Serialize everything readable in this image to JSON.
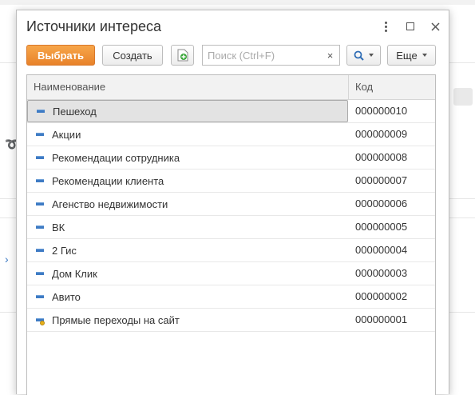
{
  "dialog": {
    "title": "Источники интереса",
    "window_controls": [
      "more-vert-icon",
      "maximize-icon",
      "close-icon"
    ]
  },
  "toolbar": {
    "select_label": "Выбрать",
    "create_label": "Создать",
    "add_icon": "add-document-icon",
    "search_placeholder": "Поиск (Ctrl+F)",
    "search_value": "",
    "clear_label": "×",
    "search_icon": "search-icon",
    "more_label": "Еще"
  },
  "table": {
    "columns": {
      "name": "Наименование",
      "code": "Код"
    },
    "rows": [
      {
        "name": "Пешеход",
        "code": "000000010",
        "selected": true,
        "icon": "catalog-item-icon"
      },
      {
        "name": "Акции",
        "code": "000000009",
        "icon": "catalog-item-icon"
      },
      {
        "name": "Рекомендации сотрудника",
        "code": "000000008",
        "icon": "catalog-item-icon"
      },
      {
        "name": "Рекомендации клиента",
        "code": "000000007",
        "icon": "catalog-item-icon"
      },
      {
        "name": "Агенство недвижимости",
        "code": "000000006",
        "icon": "catalog-item-icon"
      },
      {
        "name": "ВК",
        "code": "000000005",
        "icon": "catalog-item-icon"
      },
      {
        "name": "2 Гис",
        "code": "000000004",
        "icon": "catalog-item-icon"
      },
      {
        "name": "Дом Клик",
        "code": "000000003",
        "icon": "catalog-item-icon"
      },
      {
        "name": "Авито",
        "code": "000000002",
        "icon": "catalog-item-icon"
      },
      {
        "name": "Прямые переходы на сайт",
        "code": "000000001",
        "icon": "predefined-item-icon"
      }
    ]
  },
  "colors": {
    "primary_button": "#e8822a",
    "item_icon": "#3e7bc4",
    "predefined_marker": "#e8b01a",
    "selection": "#e3e3e3"
  }
}
